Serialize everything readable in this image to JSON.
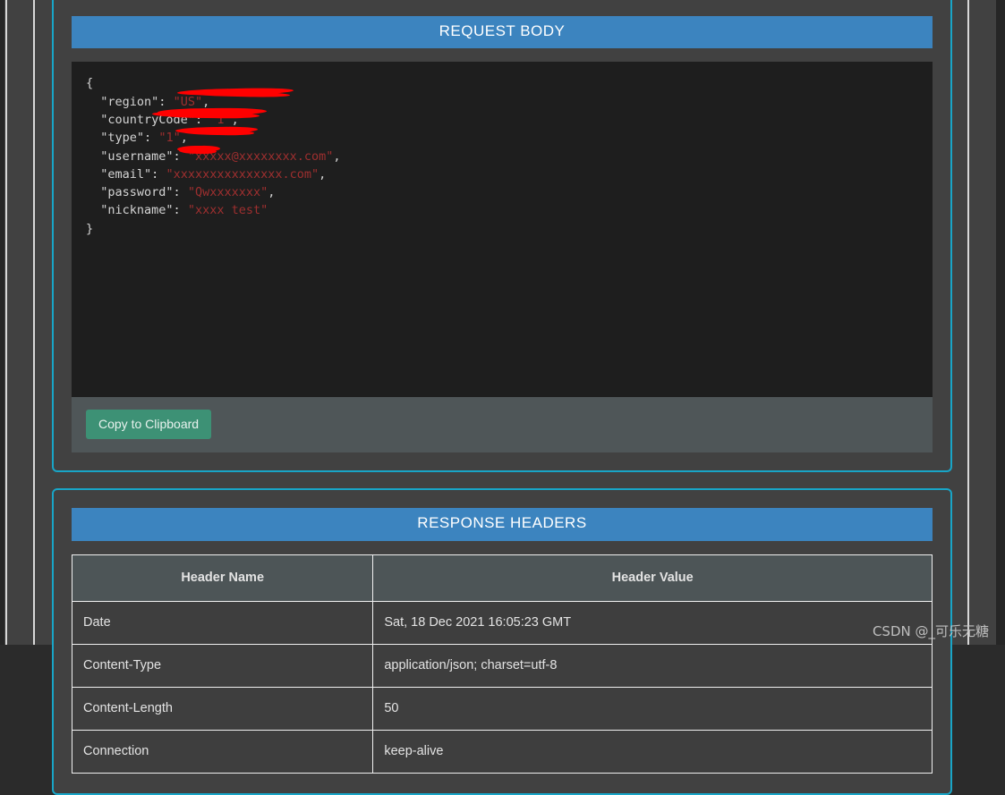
{
  "request_section": {
    "title": "REQUEST BODY",
    "code_lines": [
      {
        "indent": 0,
        "text": "{",
        "type": "punc"
      },
      {
        "indent": 1,
        "key": "\"region\"",
        "value": "\"US\"",
        "trailing": ","
      },
      {
        "indent": 1,
        "key": "\"countryCode\"",
        "value": "\"1\"",
        "trailing": ","
      },
      {
        "indent": 1,
        "key": "\"type\"",
        "value": "\"1\"",
        "trailing": ","
      },
      {
        "indent": 1,
        "key": "\"username\"",
        "value": "\"[redacted]@[redacted].com\"",
        "trailing": ",",
        "redacted": true
      },
      {
        "indent": 1,
        "key": "\"email\"",
        "value": "\"[redacted].com\"",
        "trailing": ",",
        "redacted": true
      },
      {
        "indent": 1,
        "key": "\"password\"",
        "value": "\"[redacted]\"",
        "trailing": ",",
        "redacted": true
      },
      {
        "indent": 1,
        "key": "\"nickname\"",
        "value": "\"[redacted] test\"",
        "trailing": "",
        "redacted": true
      },
      {
        "indent": 0,
        "text": "}",
        "type": "punc"
      }
    ],
    "copy_button_label": "Copy to Clipboard"
  },
  "response_section": {
    "title": "RESPONSE HEADERS",
    "table": {
      "columns": [
        "Header Name",
        "Header Value"
      ],
      "rows": [
        [
          "Date",
          "Sat, 18 Dec 2021 16:05:23 GMT"
        ],
        [
          "Content-Type",
          "application/json; charset=utf-8"
        ],
        [
          "Content-Length",
          "50"
        ],
        [
          "Connection",
          "keep-alive"
        ]
      ]
    }
  },
  "watermark": {
    "text": "CSDN @_可乐无糖"
  },
  "colors": {
    "panel_border": "#18a5c7",
    "section_header": "#3c84bf",
    "code_background": "#1e1e1e",
    "copy_button": "#3d9175",
    "redaction": "#ff0000",
    "page_background": "#414141"
  }
}
